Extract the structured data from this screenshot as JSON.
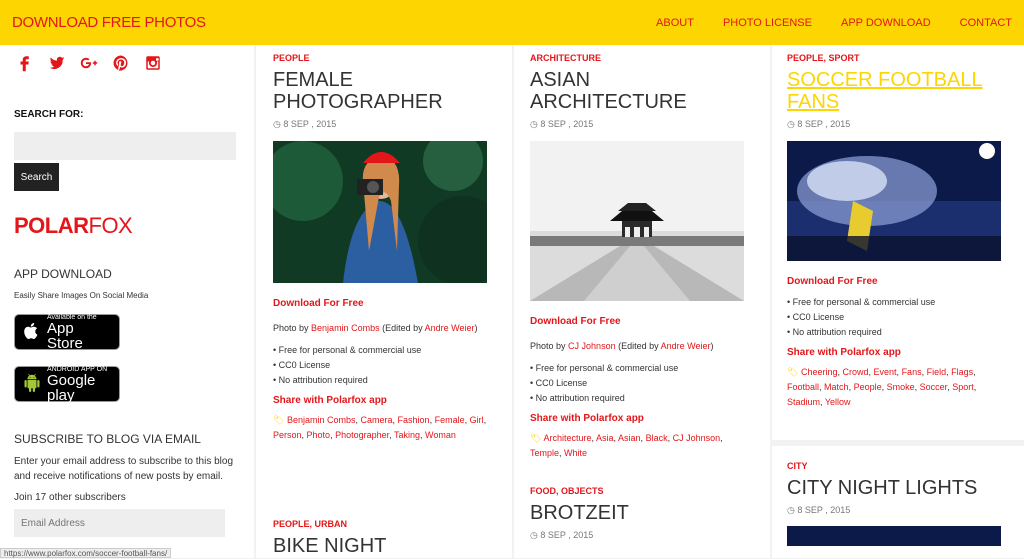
{
  "header": {
    "brand": "DOWNLOAD FREE PHOTOS",
    "nav": [
      "ABOUT",
      "PHOTO LICENSE",
      "APP DOWNLOAD",
      "CONTACT"
    ]
  },
  "sidebar": {
    "social_icons": [
      "facebook-icon",
      "twitter-icon",
      "google-plus-icon",
      "pinterest-icon",
      "instagram-icon"
    ],
    "search_label": "SEARCH FOR:",
    "search_button": "Search",
    "logo_bold": "POLAR",
    "logo_light": "FOX",
    "app_heading": "APP DOWNLOAD",
    "app_sub": "Easily Share Images On Social Media",
    "appstore_small": "Available on the",
    "appstore_big": "App Store",
    "gplay_small": "ANDROID APP ON",
    "gplay_big": "Google play",
    "subscribe_heading": "SUBSCRIBE TO BLOG VIA EMAIL",
    "subscribe_text": "Enter your email address to subscribe to this blog and receive notifications of new posts by email.",
    "join_text": "Join 17 other subscribers",
    "email_placeholder": "Email Address"
  },
  "common": {
    "download": "Download For Free",
    "lic1": "Free for personal & commercial use",
    "lic2": "CC0 License",
    "lic3": "No attribution required",
    "share": "Share with Polarfox app"
  },
  "posts": [
    {
      "cat": "PEOPLE",
      "title": "FEMALE PHOTOGRAPHER",
      "date": "8 SEP , 2015",
      "photo_by": "Photo by",
      "author": "Benjamin Combs",
      "edited_prefix": "(Edited by",
      "editor": "Andre Weier",
      "edited_suffix": ")",
      "tags": [
        "Benjamin Combs",
        "Camera",
        "Fashion",
        "Female",
        "Girl",
        "Person",
        "Photo",
        "Photographer",
        "Taking",
        "Woman"
      ]
    },
    {
      "cat": "ARCHITECTURE",
      "title": "ASIAN ARCHITECTURE",
      "date": "8 SEP , 2015",
      "photo_by": "Photo by",
      "author": "CJ Johnson",
      "edited_prefix": "(Edited by",
      "editor": "Andre Weier",
      "edited_suffix": ")",
      "tags": [
        "Architecture",
        "Asia",
        "Asian",
        "Black",
        "CJ Johnson",
        "Temple",
        "White"
      ]
    },
    {
      "cat": "PEOPLE, SPORT",
      "title": "SOCCER FOOTBALL FANS",
      "date": "8 SEP , 2015",
      "tags": [
        "Cheering",
        "Crowd",
        "Event",
        "Fans",
        "Field",
        "Flags",
        "Football",
        "Match",
        "People",
        "Smoke",
        "Soccer",
        "Sport",
        "Stadium",
        "Yellow"
      ]
    },
    {
      "cat": "PEOPLE, URBAN",
      "title": "BIKE NIGHT"
    },
    {
      "cat": "FOOD, OBJECTS",
      "title": "BROTZEIT",
      "date": "8 SEP , 2015"
    },
    {
      "cat": "CITY",
      "title": "CITY NIGHT LIGHTS",
      "date": "8 SEP , 2015"
    }
  ],
  "status_url": "https://www.polarfox.com/soccer-football-fans/"
}
